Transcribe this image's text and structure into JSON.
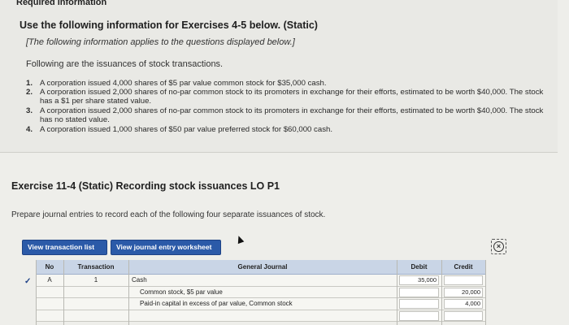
{
  "info": {
    "required": "Required information",
    "heading": "Use the following information for Exercises 4-5 below. (Static)",
    "note": "[The following information applies to the questions displayed below.]",
    "intro": "Following are the issuances of stock transactions.",
    "items": [
      {
        "num": "1.",
        "text": "A corporation issued 4,000 shares of $5 par value common stock for $35,000 cash."
      },
      {
        "num": "2.",
        "text": "A corporation issued 2,000 shares of no-par common stock to its promoters in exchange for their efforts, estimated to be worth $40,000. The stock has a $1 per share stated value."
      },
      {
        "num": "3.",
        "text": "A corporation issued 2,000 shares of no-par common stock to its promoters in exchange for their efforts, estimated to be worth $40,000. The stock has no stated value."
      },
      {
        "num": "4.",
        "text": "A corporation issued 1,000 shares of $50 par value preferred stock for $60,000 cash."
      }
    ]
  },
  "exercise": {
    "title": "Exercise 11-4 (Static) Recording stock issuances LO P1",
    "prompt": "Prepare journal entries to record each of the following four separate issuances of stock."
  },
  "buttons": {
    "view_list": "View transaction list",
    "view_worksheet": "View journal entry worksheet"
  },
  "journal": {
    "headers": {
      "no": "No",
      "transaction": "Transaction",
      "general_journal": "General Journal",
      "debit": "Debit",
      "credit": "Credit"
    },
    "rows": [
      {
        "no": "A",
        "transaction": "1",
        "account": "Cash",
        "debit": "35,000",
        "credit": ""
      },
      {
        "no": "",
        "transaction": "",
        "account": "Common stock, $5 par value",
        "debit": "",
        "credit": "20,000"
      },
      {
        "no": "",
        "transaction": "",
        "account": "Paid-in capital in excess of par value, Common stock",
        "debit": "",
        "credit": "4,000"
      },
      {
        "no": "",
        "transaction": "",
        "account": "",
        "debit": "",
        "credit": ""
      }
    ]
  }
}
